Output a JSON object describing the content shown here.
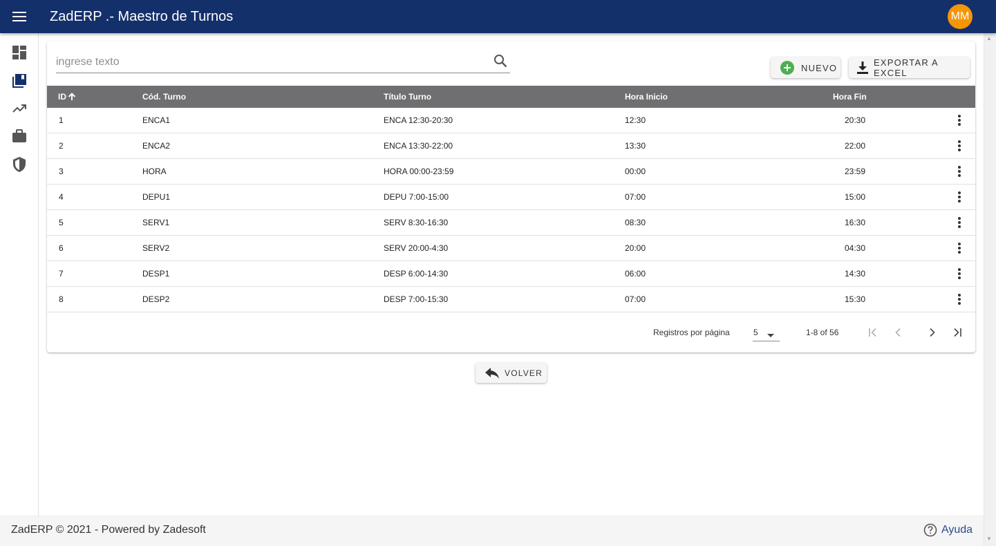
{
  "app": {
    "title": "ZadERP .- Maestro de Turnos",
    "user_initials": "MM",
    "colors": {
      "appbar": "#14306b",
      "avatar": "#f59508",
      "header_row": "#6f6f71",
      "add_icon": "#4caf50"
    }
  },
  "sidebar": {
    "items": [
      {
        "icon": "dashboard-icon"
      },
      {
        "icon": "library-books-icon"
      },
      {
        "icon": "trending-up-icon"
      },
      {
        "icon": "briefcase-icon"
      },
      {
        "icon": "shield-icon"
      }
    ]
  },
  "search": {
    "placeholder": "ingrese texto",
    "value": ""
  },
  "toolbar": {
    "new_label": "NUEVO",
    "export_label": "EXPORTAR A EXCEL"
  },
  "table": {
    "columns": [
      "ID",
      "Cód. Turno",
      "Título Turno",
      "Hora Inicio",
      "Hora Fin"
    ],
    "sort": {
      "column": "ID",
      "direction": "asc"
    },
    "rows": [
      {
        "id": "1",
        "code": "ENCA1",
        "title": "ENCA 12:30-20:30",
        "start": "12:30",
        "end": "20:30"
      },
      {
        "id": "2",
        "code": "ENCA2",
        "title": "ENCA 13:30-22:00",
        "start": "13:30",
        "end": "22:00"
      },
      {
        "id": "3",
        "code": "HORA",
        "title": "HORA 00:00-23:59",
        "start": "00:00",
        "end": "23:59"
      },
      {
        "id": "4",
        "code": "DEPU1",
        "title": "DEPU 7:00-15:00",
        "start": "07:00",
        "end": "15:00"
      },
      {
        "id": "5",
        "code": "SERV1",
        "title": "SERV 8:30-16:30",
        "start": "08:30",
        "end": "16:30"
      },
      {
        "id": "6",
        "code": "SERV2",
        "title": "SERV 20:00-4:30",
        "start": "20:00",
        "end": "04:30"
      },
      {
        "id": "7",
        "code": "DESP1",
        "title": "DESP 6:00-14:30",
        "start": "06:00",
        "end": "14:30"
      },
      {
        "id": "8",
        "code": "DESP2",
        "title": "DESP 7:00-15:30",
        "start": "07:00",
        "end": "15:30"
      }
    ]
  },
  "pagination": {
    "rows_per_page_label": "Registros por página",
    "rows_per_page": "5",
    "range": "1-8 of 56"
  },
  "back_label": "VOLVER",
  "footer": {
    "text": "ZadERP © 2021 - Powered by Zadesoft",
    "help_label": "Ayuda"
  }
}
